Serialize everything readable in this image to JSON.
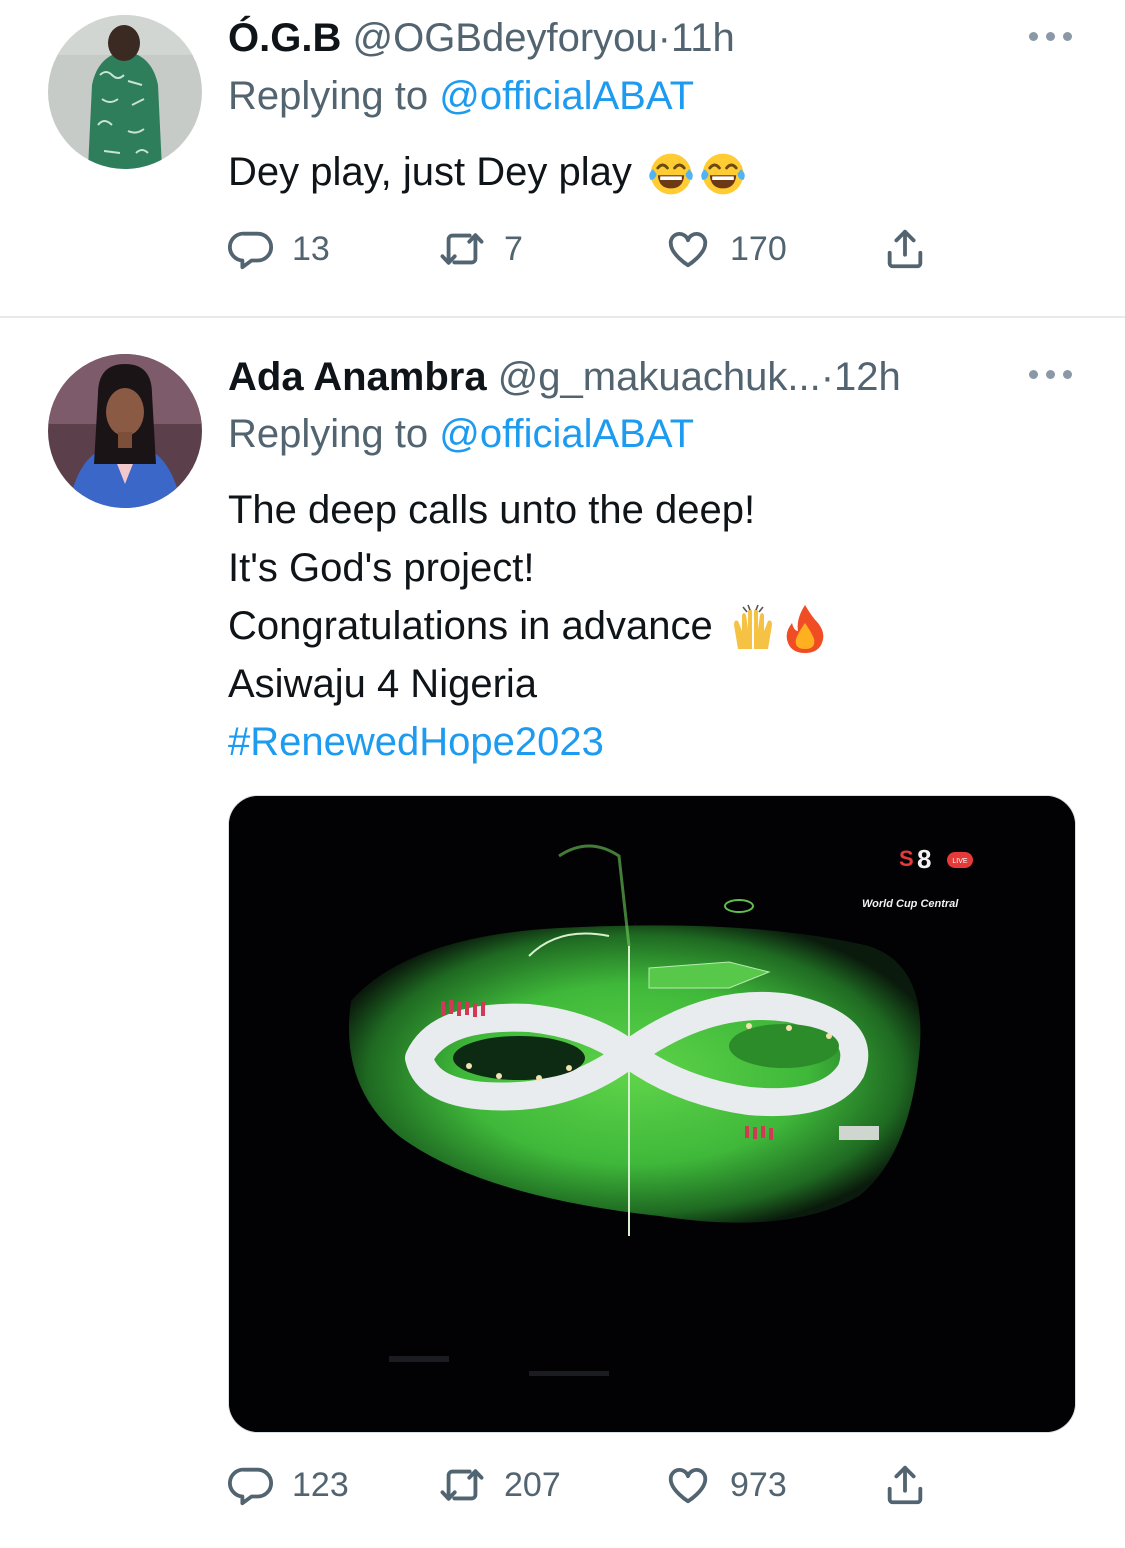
{
  "tweets": [
    {
      "name": "Ó.G.B",
      "handle": "@OGBdeyforyou",
      "time_sep": "·",
      "time": "11h",
      "reply_prefix": "Replying to ",
      "reply_mention": "@officialABAT",
      "text_lines": [
        "Dey play, just Dey play"
      ],
      "emojis": [
        "face-with-tears-of-joy",
        "face-with-tears-of-joy"
      ],
      "counts": {
        "replies": "13",
        "retweets": "7",
        "likes": "170"
      }
    },
    {
      "name": "Ada Anambra",
      "handle": "@g_makuachuk...",
      "time_sep": "·",
      "time": "12h",
      "reply_prefix": "Replying to ",
      "reply_mention": "@officialABAT",
      "text_lines": [
        "The deep calls unto the deep!",
        "It's God's project!",
        "Congratulations in advance",
        "Asiwaju 4 Nigeria"
      ],
      "emojis": [
        "raising-hands",
        "fire"
      ],
      "hashtag": "#RenewedHope2023",
      "media": {
        "overlay_text": "World Cup Central",
        "live_badge": "LIVE"
      },
      "counts": {
        "replies": "123",
        "retweets": "207",
        "likes": "973"
      }
    }
  ],
  "colors": {
    "link": "#1d9bf0",
    "meta": "#536471",
    "divider": "#e7e9ea",
    "field_green": "#3fb83a"
  },
  "icons": [
    "reply-icon",
    "retweet-icon",
    "like-icon",
    "share-icon",
    "more-icon"
  ]
}
